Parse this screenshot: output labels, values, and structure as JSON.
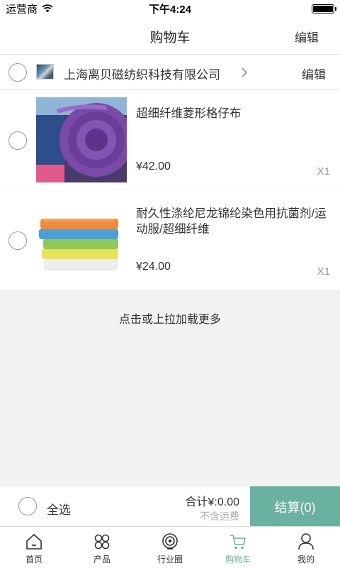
{
  "status_bar": {
    "carrier": "运营商",
    "time": "下午4:24"
  },
  "nav": {
    "title": "购物车",
    "edit": "编辑"
  },
  "shop": {
    "name": "上海离贝磁纺织科技有限公司",
    "edit": "编辑"
  },
  "items": [
    {
      "name": "超细纤维菱形格仔布",
      "price": "¥42.00",
      "qty": "X1"
    },
    {
      "name": "耐久性涤纶尼龙锦纶染色用抗菌剂/运动服/超细纤维",
      "price": "¥24.00",
      "qty": "X1"
    }
  ],
  "load_more": "点击或上拉加载更多",
  "checkout": {
    "select_all": "全选",
    "total": "合计¥:0.00",
    "shipping": "不含运费",
    "button": "结算(0)"
  },
  "tabs": [
    {
      "label": "首页",
      "icon": "home-icon"
    },
    {
      "label": "产品",
      "icon": "grid-icon"
    },
    {
      "label": "行业圈",
      "icon": "circle-icon"
    },
    {
      "label": "购物车",
      "icon": "cart-icon",
      "active": true
    },
    {
      "label": "我的",
      "icon": "person-icon"
    }
  ],
  "colors": {
    "accent": "#6bb1a0",
    "background": "#f2f2f2"
  }
}
